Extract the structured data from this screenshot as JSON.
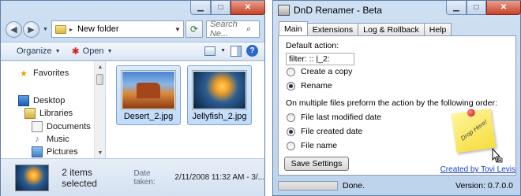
{
  "explorer": {
    "address": {
      "path_label": "New folder"
    },
    "search": {
      "placeholder": "Search Ne..."
    },
    "toolbar": {
      "organize_label": "Organize",
      "open_label": "Open"
    },
    "nav_items": [
      {
        "label": "Favorites",
        "icon": "star-icon"
      },
      {
        "label": "Desktop",
        "icon": "desktop-icon"
      },
      {
        "label": "Libraries",
        "icon": "libraries-icon"
      },
      {
        "label": "Documents",
        "icon": "documents-icon"
      },
      {
        "label": "Music",
        "icon": "music-icon"
      },
      {
        "label": "Pictures",
        "icon": "pictures-icon"
      }
    ],
    "files": [
      {
        "name": "Desert_2.jpg"
      },
      {
        "name": "Jellyfish_2.jpg"
      }
    ],
    "details": {
      "selection_count": "2 items selected",
      "date_label": "Date taken:",
      "date_value": "2/11/2008 11:32 AM - 3/..."
    }
  },
  "dnd": {
    "title": "DnD Renamer - Beta",
    "tabs": [
      "Main",
      "Extensions",
      "Log & Rollback",
      "Help"
    ],
    "default_action_label": "Default action:",
    "filter_value": "filter: :: |_2:",
    "action_options": [
      {
        "label": "Create a copy",
        "selected": false
      },
      {
        "label": "Rename",
        "selected": true
      }
    ],
    "order_label": "On multiple files preform the action by the following order:",
    "order_options": [
      {
        "label": "File last modified date",
        "selected": false
      },
      {
        "label": "File created date",
        "selected": true
      },
      {
        "label": "File name",
        "selected": false
      }
    ],
    "note_text": "Drop Here!",
    "save_label": "Save Settings",
    "credit": "Created by Tovi Levis",
    "status_text": "Done.",
    "version": "Version: 0.7.0.0"
  }
}
